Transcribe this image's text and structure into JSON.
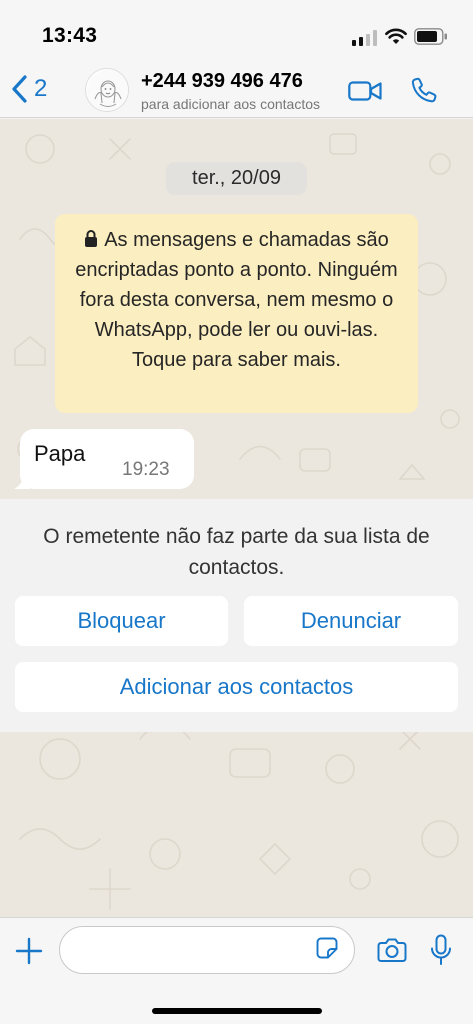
{
  "status_bar": {
    "time": "13:43"
  },
  "nav": {
    "back_count": "2",
    "contact_name": "+244 939 496 476",
    "contact_subtitle": "para adicionar aos contactos",
    "icons": [
      "chevron-left-icon",
      "video-call-icon",
      "phone-icon"
    ]
  },
  "chat": {
    "date_label": "ter., 20/09",
    "encryption_notice": "As mensagens e chamadas são encriptadas ponto a ponto. Ninguém fora desta conversa, nem mesmo o WhatsApp, pode ler ou ouvi-las. Toque para saber mais.",
    "messages": [
      {
        "text": "Papa",
        "time": "19:23",
        "direction": "incoming"
      }
    ]
  },
  "unknown_sender_panel": {
    "message": "O remetente não faz parte da sua lista de contactos.",
    "block_label": "Bloquear",
    "report_label": "Denunciar",
    "add_label": "Adicionar aos contactos"
  },
  "composer": {
    "input_value": "",
    "icons": [
      "plus-icon",
      "sticker-icon",
      "camera-icon",
      "microphone-icon"
    ]
  },
  "colors": {
    "accent": "#1877c9",
    "wallpaper": "#ece7de",
    "system_note": "#fbeec0",
    "bubble_incoming": "#ffffff"
  }
}
